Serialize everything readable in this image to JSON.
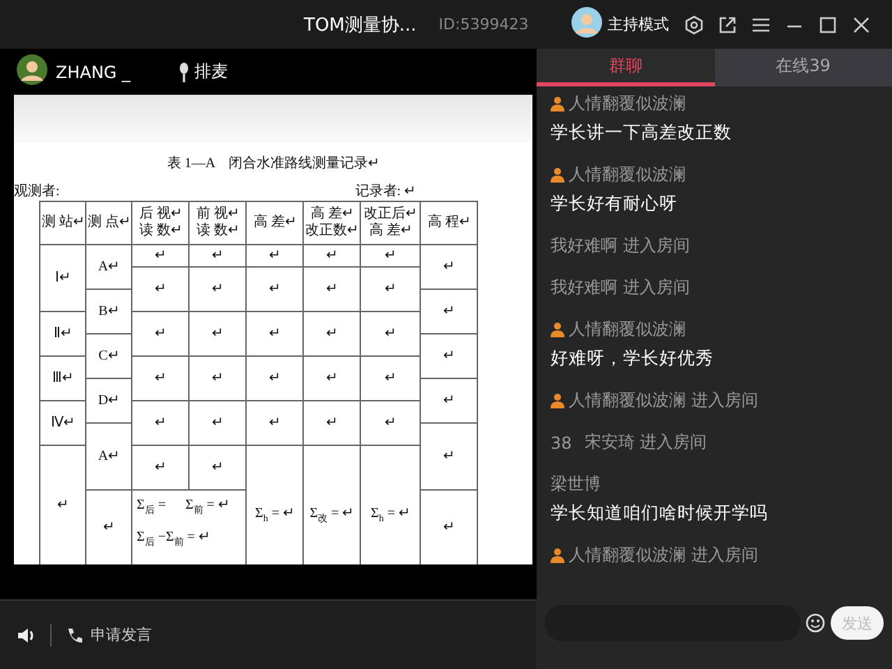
{
  "title_bar": {
    "title": "TOM测量协...",
    "room_id": "ID:5399423",
    "mode": "主持模式"
  },
  "presenter": {
    "name": "ZHANG _",
    "queue_label": "排麦"
  },
  "document": {
    "title": "表 1—A　闭合水准路线测量记录↵",
    "observer_label": "观测者:",
    "recorder_label": "记录者: ↵",
    "columns": [
      {
        "lines": [
          "测 站↵"
        ]
      },
      {
        "lines": [
          "测 点↵"
        ]
      },
      {
        "lines": [
          "后 视↵",
          "读 数↵"
        ]
      },
      {
        "lines": [
          "前 视↵",
          "读 数↵"
        ]
      },
      {
        "lines": [
          "高 差↵"
        ]
      },
      {
        "lines": [
          "高 差↵",
          "改正数↵"
        ]
      },
      {
        "lines": [
          "改正后↵",
          "高 差↵"
        ]
      },
      {
        "lines": [
          "高 程↵"
        ]
      }
    ],
    "stations": [
      "Ⅰ↵",
      "Ⅱ↵",
      "Ⅲ↵",
      "Ⅳ↵",
      "↵"
    ],
    "points": [
      "A↵",
      "B↵",
      "C↵",
      "D↵",
      "A↵",
      "↵"
    ],
    "data_rows": [
      [
        "↵",
        "↵",
        "↵",
        "↵",
        "↵"
      ],
      [
        "↵",
        "↵",
        "↵",
        "↵",
        "↵"
      ],
      [
        "↵",
        "↵",
        "↵",
        "↵",
        "↵"
      ],
      [
        "↵",
        "↵",
        "↵",
        "↵",
        "↵"
      ],
      [
        "↵",
        "↵",
        "↵",
        "↵",
        "↵"
      ],
      [
        "↵",
        "↵"
      ]
    ],
    "elevations": [
      "↵",
      "↵",
      "↵",
      "↵",
      "↵",
      "↵"
    ],
    "sums": {
      "back": "Σ$_{后}$ =",
      "front": "Σ$_{前}$ = ↵",
      "difference": "Σ$_{后}$ −Σ$_{前}$ = ↵",
      "height": "Σ$_{h}$ = ↵",
      "correction": "Σ$_{改}$ = ↵",
      "corrected_height": "Σ$_{h}$ = ↵"
    }
  },
  "bottom_bar": {
    "request_label": "申请发言"
  },
  "chat": {
    "tabs": [
      {
        "label": "群聊",
        "selected": true
      },
      {
        "label": "在线39",
        "selected": false
      }
    ],
    "messages": [
      {
        "kind": "message",
        "badge": true,
        "name": "人情翻覆似波澜",
        "text": "学长讲一下高差改正数"
      },
      {
        "kind": "message",
        "badge": true,
        "name": "人情翻覆似波澜",
        "text": "学长好有耐心呀"
      },
      {
        "kind": "join",
        "badge": false,
        "name": "我好难啊",
        "action": "进入房间"
      },
      {
        "kind": "join",
        "badge": false,
        "name": "我好难啊",
        "action": "进入房间"
      },
      {
        "kind": "message",
        "badge": true,
        "name": "人情翻覆似波澜",
        "text": "好难呀，学长好优秀"
      },
      {
        "kind": "join",
        "badge": true,
        "name": "人情翻覆似波澜",
        "action": "进入房间"
      },
      {
        "kind": "join",
        "badge": false,
        "level": "38",
        "name": "宋安琦",
        "action": "进入房间"
      },
      {
        "kind": "message",
        "badge": false,
        "name": "梁世博",
        "text": "学长知道咱们啥时候开学吗"
      },
      {
        "kind": "join",
        "badge": true,
        "name": "人情翻覆似波澜",
        "action": "进入房间"
      }
    ],
    "send_label": "发送"
  }
}
